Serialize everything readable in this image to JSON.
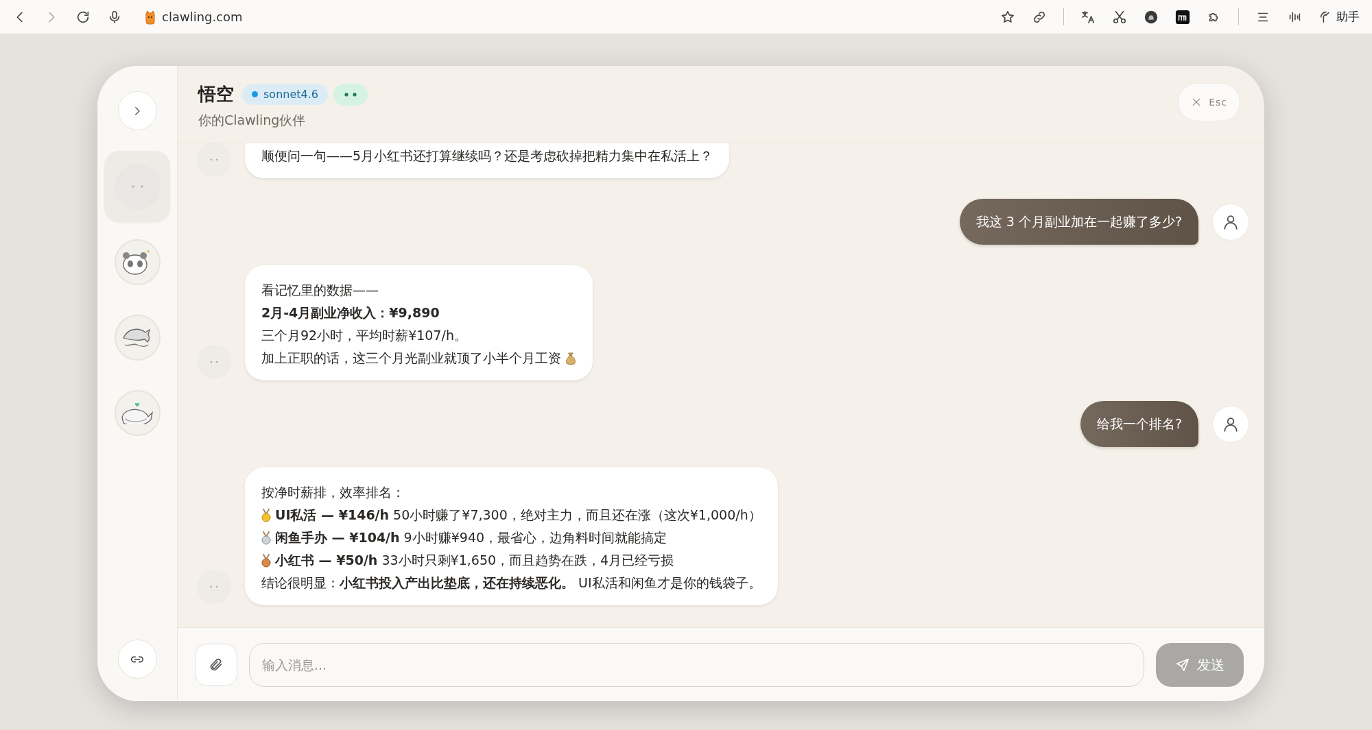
{
  "browser": {
    "url": "clawling.com",
    "assistant_label": "助手"
  },
  "agent": {
    "name": "悟空",
    "model": "sonnet4.6",
    "subtitle": "你的Clawling伙伴"
  },
  "close_button": {
    "label": "Esc"
  },
  "sidebar": {
    "avatars": [
      {
        "kind": "blank",
        "selected": true
      },
      {
        "kind": "panda",
        "selected": false
      },
      {
        "kind": "dolphin",
        "selected": false
      },
      {
        "kind": "whale",
        "selected": false
      }
    ]
  },
  "messages": [
    {
      "kind": "agent",
      "lines": [
        {
          "text": "顺便问一句——5月小红书还打算继续吗？还是考虑砍掉把精力集中在私活上？"
        }
      ]
    },
    {
      "kind": "user",
      "text": "我这 3 个月副业加在一起赚了多少?"
    },
    {
      "kind": "agent",
      "lines": [
        {
          "text": "看记忆里的数据——"
        },
        {
          "text": "2月-4月副业净收入：¥9,890",
          "bold": true
        },
        {
          "text": "三个月92小时，平均时薪¥107/h。"
        },
        {
          "text": "加上正职的话，这三个月光副业就顶了小半个月工资",
          "kind": "money"
        }
      ]
    },
    {
      "kind": "user",
      "text": "给我一个排名?"
    },
    {
      "kind": "agent",
      "lines": [
        {
          "text": "按净时薪排，效率排名："
        },
        {
          "kind": "gold",
          "text": "**UI私活 — ¥146/h** 50小时赚了¥7,300，绝对主力，而且还在涨（这次¥1,000/h）"
        },
        {
          "kind": "silver",
          "text": "**闲鱼手办 — ¥104/h** 9小时赚¥940，最省心，边角料时间就能搞定"
        },
        {
          "kind": "bronze",
          "text": "**小红书 — ¥50/h** 33小时只剩¥1,650，而且趋势在跌，4月已经亏损"
        },
        {
          "text": "结论很明显：**小红书投入产出比垫底，还在持续恶化。** UI私活和闲鱼才是你的钱袋子。"
        }
      ]
    }
  ],
  "composer": {
    "placeholder": "输入消息...",
    "send_label": "发送"
  }
}
